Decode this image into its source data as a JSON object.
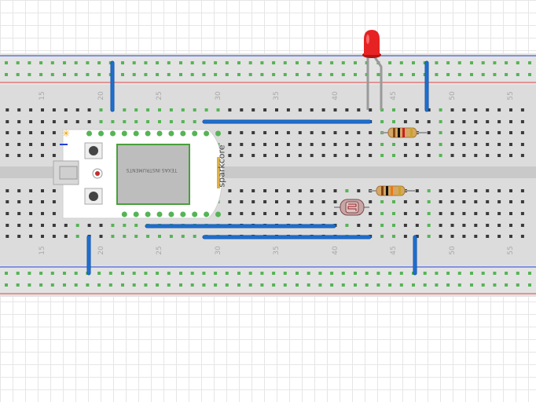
{
  "board": {
    "brand_label": "sparkcore",
    "chip_label": "TEXAS INSTRUMENTS"
  },
  "row_numbers": [
    "15",
    "20",
    "25",
    "30",
    "35",
    "40",
    "45",
    "50",
    "55"
  ],
  "colors": {
    "wire": "#1e6fcf",
    "led": "#e62222",
    "rail_blue": "#2243d6",
    "rail_red": "#e04646",
    "hole": "#3a3a3a",
    "connected_hole": "#55b455",
    "breadboard": "#dcdcdc",
    "core_board": "#ffffff",
    "chip_green": "#4aa03c"
  },
  "components": {
    "led": "red-led",
    "resistor_top": "resistor",
    "resistor_bottom": "resistor",
    "photoresistor": "photoresistor",
    "wires": 7
  }
}
